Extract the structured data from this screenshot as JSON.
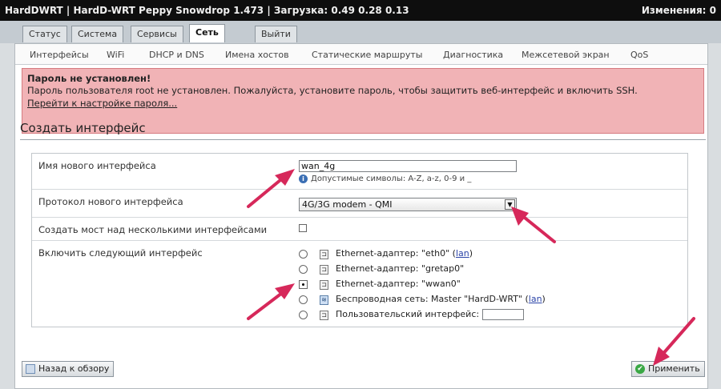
{
  "header": {
    "title": "HardDWRT | HardD-WRT Peppy Snowdrop 1.473 | Загрузка: 0.49 0.28 0.13",
    "changes": "Изменения: 0"
  },
  "tabs": [
    {
      "label": "Статус",
      "active": false
    },
    {
      "label": "Система",
      "active": false
    },
    {
      "label": "Сервисы",
      "active": false
    },
    {
      "label": "Сеть",
      "active": true
    },
    {
      "label": "Выйти",
      "active": false
    }
  ],
  "subnav": [
    "Интерфейсы",
    "WiFi",
    "DHCP и DNS",
    "Имена хостов",
    "Статические маршруты",
    "Диагностика",
    "Межсетевой экран",
    "QoS"
  ],
  "alert": {
    "title": "Пароль не установлен!",
    "text": "Пароль пользователя root не установлен. Пожалуйста, установите пароль, чтобы защитить веб-интерфейс и включить SSH.",
    "link": "Перейти к настройке пароля..."
  },
  "section_title": "Создать интерфейс",
  "form": {
    "name_label": "Имя нового интерфейса",
    "name_value": "wan_4g",
    "name_hint": "Допустимые символы: A-Z, a-z, 0-9 и _",
    "protocol_label": "Протокол нового интерфейса",
    "protocol_value": "4G/3G modem - QMI",
    "bridge_label": "Создать мост над несколькими интерфейсами",
    "include_label": "Включить следующий интерфейс",
    "interfaces": [
      {
        "prefix": "Ethernet-адаптер: \"eth0\" (",
        "link": "lan",
        "suffix": ")",
        "type": "ethernet",
        "checked": false
      },
      {
        "prefix": "Ethernet-адаптер: \"gretap0\"",
        "link": "",
        "suffix": "",
        "type": "ethernet",
        "checked": false
      },
      {
        "prefix": "Ethernet-адаптер: \"wwan0\"",
        "link": "",
        "suffix": "",
        "type": "ethernet",
        "checked": true
      },
      {
        "prefix": "Беспроводная сеть: Master \"HardD-WRT\" (",
        "link": "lan",
        "suffix": ")",
        "type": "wifi",
        "checked": false
      },
      {
        "prefix": "Пользовательский интерфейс:",
        "link": "",
        "suffix": "",
        "type": "custom",
        "checked": false
      }
    ]
  },
  "buttons": {
    "back": "Назад к обзору",
    "apply": "Применить"
  },
  "colors": {
    "annotation_arrow": "#d6285a",
    "alert_bg": "#f1b3b6",
    "topbar_bg": "#0e0e0e"
  }
}
